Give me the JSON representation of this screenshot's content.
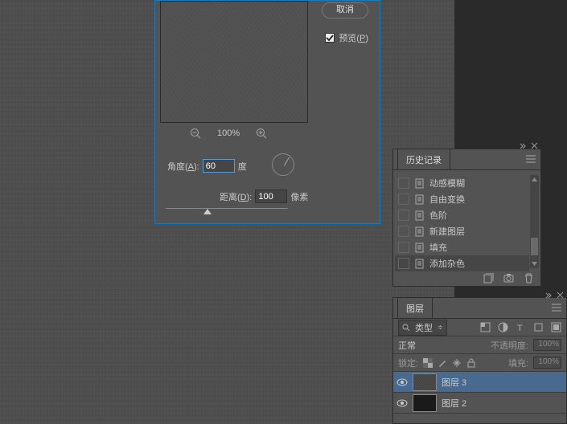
{
  "dialog": {
    "cancel": "取消",
    "preview_label": "预览(",
    "preview_key": "P",
    "preview_close": ")",
    "zoom_pct": "100%",
    "angle_label": "角度(",
    "angle_key": "A",
    "angle_close": "):",
    "angle_value": "60",
    "angle_unit": "度",
    "distance_label": "距离(",
    "distance_key": "D",
    "distance_close": "):",
    "distance_value": "100",
    "distance_unit": "像素"
  },
  "history": {
    "title": "历史记录",
    "items": [
      "动感模糊",
      "自由变换",
      "色阶",
      "新建图层",
      "填充",
      "添加杂色"
    ]
  },
  "layers": {
    "title": "图层",
    "type_label": "类型",
    "blend_mode": "正常",
    "opacity_label": "不透明度:",
    "opacity_value": "100%",
    "lock_label": "锁定:",
    "fill_label": "填充:",
    "fill_value": "100%",
    "items": [
      {
        "name": "图层 3",
        "selected": true
      },
      {
        "name": "图层 2",
        "selected": false
      }
    ]
  }
}
